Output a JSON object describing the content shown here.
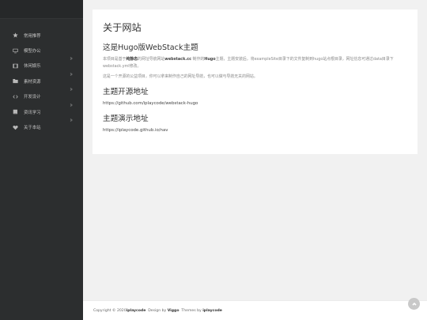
{
  "sidebar": {
    "items": [
      {
        "label": "常用推荐",
        "icon": "star-icon",
        "has_arrow": false
      },
      {
        "label": "模型办公",
        "icon": "monitor-icon",
        "has_arrow": true
      },
      {
        "label": "休闲娱乐",
        "icon": "film-icon",
        "has_arrow": true
      },
      {
        "label": "素材资源",
        "icon": "folder-icon",
        "has_arrow": true
      },
      {
        "label": "开发设计",
        "icon": "code-icon",
        "has_arrow": true
      },
      {
        "label": "资讯学习",
        "icon": "book-icon",
        "has_arrow": true
      },
      {
        "label": "关于本站",
        "icon": "heart-icon",
        "has_arrow": false
      }
    ]
  },
  "content": {
    "page_title": "关于网站",
    "intro_heading": "这是Hugo版WebStack主题",
    "intro_p1_a": "本项目是基于",
    "intro_p1_b": "纯静态",
    "intro_p1_c": "的网址导航网站",
    "intro_p1_d": "webstack.cc",
    "intro_p1_e": " 制作的",
    "intro_p1_f": "Hugo",
    "intro_p1_g": "主题，主题安装后，将exampleSite目录下的文件复制到hugo站点根目录，网址信息可通过data目录下webstack.yml修改。",
    "intro_p2": "这是一个开源的公益项目，你可以拿来制作自己的网址导航，也可以做与导航无关的网站。",
    "source_heading": "主题开源地址",
    "source_url": "https://github.com/iplaycode/webstack-hugo",
    "demo_heading": "主题演示地址",
    "demo_url": "https://iplaycode.github.io/nav"
  },
  "footer": {
    "copyright": "Copyright © 2020 ",
    "owner": "iplaycode",
    "design_by": "  Design by ",
    "designer": "Viggo",
    "themes_by": "  Themes by ",
    "theme_author": "iplaycode"
  }
}
